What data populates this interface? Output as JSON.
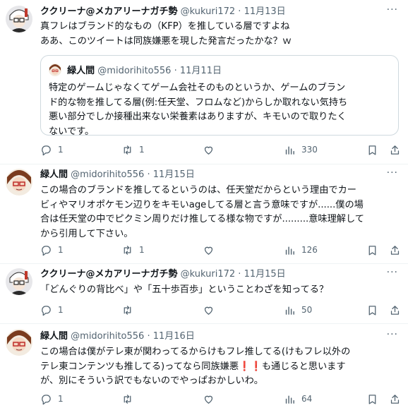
{
  "tweets": [
    {
      "name": "ククリーナ@メカアリーナガチ勢",
      "handle": "@kukuri172",
      "dot": "·",
      "date": "11月13日",
      "lines": [
        "真フレはブランド的なもの（KFP）を推している層ですよね",
        "ああ、このツイートは同族嫌悪を現した発言だったかな？ｗ"
      ],
      "quote": {
        "name": "緑人間",
        "handle": "@midorihito556",
        "dot": "·",
        "date": "11月11日",
        "lines": [
          "特定のゲームじゃなくてゲーム会社そのものというか、ゲームのブラン",
          "ド的な物を推してる層(例:任天堂、フロムなど)からしか取れない気持ち",
          "悪い部分でしか接種出来ない栄養素はありますが、キモいので取りたく",
          "ないです。"
        ]
      },
      "replies": "1",
      "retweets": "1",
      "likes": "",
      "views": "330"
    },
    {
      "name": "緑人間",
      "handle": "@midorihito556",
      "dot": "·",
      "date": "11月15日",
      "lines": [
        "この場合のブランドを推してるというのは、任天堂だからという理由でカー",
        "ビィやマリオポケモン辺りをキモいageしてる層と言う意味ですが......僕の場",
        "合は任天堂の中でピクミン周りだけ推してる様な物ですが.........意味理解して",
        "から引用して下さい。"
      ],
      "replies": "1",
      "retweets": "1",
      "likes": "",
      "views": "126"
    },
    {
      "name": "ククリーナ@メカアリーナガチ勢",
      "handle": "@kukuri172",
      "dot": "·",
      "date": "11月15日",
      "lines": [
        "「どんぐりの背比べ」や「五十歩百歩」ということわざを知ってる？"
      ],
      "replies": "1",
      "retweets": "",
      "likes": "",
      "views": "50"
    },
    {
      "name": "緑人間",
      "handle": "@midorihito556",
      "dot": "·",
      "date": "11月16日",
      "lines": [
        "この場合は僕がテレ東が関わってるからけもフレ推してる(けもフレ以外の",
        "テレ東コンテンツも推してる)ってなら同族嫌悪",
        "が、別にそういう訳でもないのでやっぱおかしいわ。"
      ],
      "line2_tail": "も通じると思います",
      "bang": "❗❗",
      "replies": "1",
      "retweets": "",
      "likes": "",
      "views": "64"
    }
  ],
  "more_label": "···",
  "icons": {
    "reply": "reply-icon",
    "retweet": "retweet-icon",
    "like": "like-icon",
    "views": "views-icon",
    "bookmark": "bookmark-icon",
    "share": "share-icon"
  },
  "colors": {
    "text": "#0f1419",
    "secondary": "#536471",
    "border": "#cfd9de",
    "exclaim": "#e0245e"
  }
}
